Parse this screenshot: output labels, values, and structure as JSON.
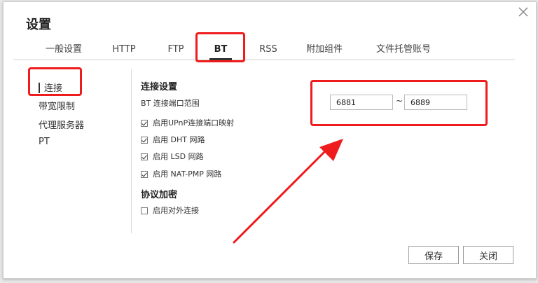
{
  "dialog": {
    "title": "设置",
    "close_label": "×"
  },
  "tabs": [
    "一般设置",
    "HTTP",
    "FTP",
    "BT",
    "RSS",
    "附加组件",
    "文件托管账号"
  ],
  "active_tab": "BT",
  "sidebar": {
    "items": [
      "连接",
      "带宽限制",
      "代理服务器",
      "PT"
    ],
    "active": "连接"
  },
  "connection": {
    "heading": "连接设置",
    "port_range_label": "BT 连接端口范围",
    "port_from": "6881",
    "port_separator": "~",
    "port_to": "6889",
    "options": [
      {
        "label": "启用UPnP连接端口映射",
        "checked": true
      },
      {
        "label": "启用 DHT 网路",
        "checked": true
      },
      {
        "label": "启用 LSD 网路",
        "checked": true
      },
      {
        "label": "启用 NAT-PMP 网路",
        "checked": true
      }
    ]
  },
  "encryption": {
    "heading": "协议加密",
    "options": [
      {
        "label": "启用对外连接",
        "checked": false
      }
    ]
  },
  "buttons": {
    "save": "保存",
    "close": "关闭"
  },
  "annotation": {
    "highlight_color": "#ee1c1c"
  }
}
